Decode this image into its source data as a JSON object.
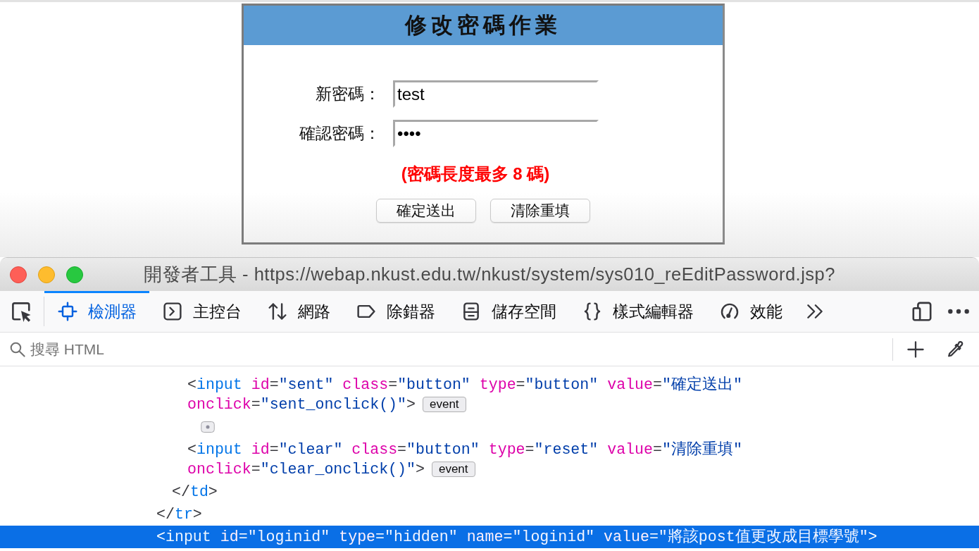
{
  "form": {
    "title": "修改密碼作業",
    "fields": [
      {
        "label": "新密碼：",
        "value": "test"
      },
      {
        "label": "確認密碼：",
        "value": "••••"
      }
    ],
    "hint": "(密碼長度最多 8 碼)",
    "buttons": [
      "確定送出",
      "清除重填"
    ]
  },
  "devtools": {
    "title": "開發者工具 - https://webap.nkust.edu.tw/nkust/system/sys010_reEditPassword.jsp?",
    "tabs": [
      {
        "label": "檢測器",
        "selected": true
      },
      {
        "label": "主控台",
        "selected": false
      },
      {
        "label": "網路",
        "selected": false
      },
      {
        "label": "除錯器",
        "selected": false
      },
      {
        "label": "儲存空間",
        "selected": false
      },
      {
        "label": "樣式編輯器",
        "selected": false
      },
      {
        "label": "效能",
        "selected": false
      }
    ],
    "search": {
      "placeholder": "搜尋 HTML"
    },
    "markup": [
      {
        "kind": "element",
        "selected": false,
        "children": [
          {
            "kind": "element",
            "selected": false,
            "children": [
              {
                "kind": "element",
                "selected": false,
                "lines": [
                  [
                    {
                      "kind": "punct",
                      "text": "<"
                    },
                    {
                      "kind": "tag",
                      "text": "input"
                    },
                    {
                      "kind": "attr",
                      "text": " id"
                    },
                    {
                      "kind": "punct",
                      "text": "="
                    },
                    {
                      "kind": "value",
                      "text": "\"sent\""
                    },
                    {
                      "kind": "attr",
                      "text": " class"
                    },
                    {
                      "kind": "punct",
                      "text": "="
                    },
                    {
                      "kind": "value",
                      "text": "\"button\""
                    },
                    {
                      "kind": "attr",
                      "text": " type"
                    },
                    {
                      "kind": "punct",
                      "text": "="
                    },
                    {
                      "kind": "value",
                      "text": "\"button\""
                    },
                    {
                      "kind": "attr",
                      "text": " value"
                    },
                    {
                      "kind": "punct",
                      "text": "="
                    },
                    {
                      "kind": "value",
                      "text": "\"確定送出\""
                    }
                  ],
                  [
                    {
                      "kind": "attr",
                      "text": "onclick"
                    },
                    {
                      "kind": "punct",
                      "text": "="
                    },
                    {
                      "kind": "value",
                      "text": "\"sent_onclick()\""
                    },
                    {
                      "kind": "punct",
                      "text": ">"
                    }
                  ]
                ],
                "badge": "event"
              },
              {
                "kind": "whitespace",
                "selected": false
              },
              {
                "kind": "element",
                "selected": false,
                "lines": [
                  [
                    {
                      "kind": "punct",
                      "text": "<"
                    },
                    {
                      "kind": "tag",
                      "text": "input"
                    },
                    {
                      "kind": "attr",
                      "text": " id"
                    },
                    {
                      "kind": "punct",
                      "text": "="
                    },
                    {
                      "kind": "value",
                      "text": "\"clear\""
                    },
                    {
                      "kind": "attr",
                      "text": " class"
                    },
                    {
                      "kind": "punct",
                      "text": "="
                    },
                    {
                      "kind": "value",
                      "text": "\"button\""
                    },
                    {
                      "kind": "attr",
                      "text": " type"
                    },
                    {
                      "kind": "punct",
                      "text": "="
                    },
                    {
                      "kind": "value",
                      "text": "\"reset\""
                    },
                    {
                      "kind": "attr",
                      "text": " value"
                    },
                    {
                      "kind": "punct",
                      "text": "="
                    },
                    {
                      "kind": "value",
                      "text": "\"清除重填\""
                    }
                  ],
                  [
                    {
                      "kind": "attr",
                      "text": "onclick"
                    },
                    {
                      "kind": "punct",
                      "text": "="
                    },
                    {
                      "kind": "value",
                      "text": "\"clear_onclick()\""
                    },
                    {
                      "kind": "punct",
                      "text": ">"
                    }
                  ]
                ],
                "badge": "event"
              }
            ],
            "close": [
              {
                "kind": "punct",
                "text": "</"
              },
              {
                "kind": "tag",
                "text": "td"
              },
              {
                "kind": "punct",
                "text": ">"
              }
            ]
          }
        ],
        "close": [
          {
            "kind": "punct",
            "text": "</"
          },
          {
            "kind": "tag",
            "text": "tr"
          },
          {
            "kind": "punct",
            "text": ">"
          }
        ]
      },
      {
        "kind": "element",
        "selected": true,
        "lines": [
          [
            {
              "kind": "punct",
              "text": "<"
            },
            {
              "kind": "tag",
              "text": "input"
            },
            {
              "kind": "attr",
              "text": " id"
            },
            {
              "kind": "punct",
              "text": "="
            },
            {
              "kind": "value",
              "text": "\"loginid\""
            },
            {
              "kind": "attr",
              "text": " type"
            },
            {
              "kind": "punct",
              "text": "="
            },
            {
              "kind": "value",
              "text": "\"hidden\""
            },
            {
              "kind": "attr",
              "text": " name"
            },
            {
              "kind": "punct",
              "text": "="
            },
            {
              "kind": "value",
              "text": "\"loginid\""
            },
            {
              "kind": "attr",
              "text": " value"
            },
            {
              "kind": "punct",
              "text": "="
            },
            {
              "kind": "value",
              "text": "\"將該post值更改成目標學號\""
            },
            {
              "kind": "punct",
              "text": ">"
            }
          ]
        ]
      }
    ]
  }
}
